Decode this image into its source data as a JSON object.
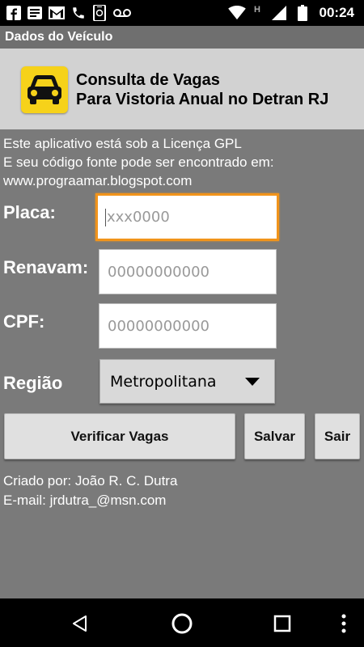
{
  "status_bar": {
    "time": "00:24",
    "network_indicator": "H",
    "icons": [
      "facebook-icon",
      "news-icon",
      "gmail-icon",
      "phone-icon",
      "phone-message-icon",
      "voicemail-icon",
      "wifi-icon",
      "signal-icon",
      "battery-icon"
    ]
  },
  "title_bar": {
    "title": "Dados do Veículo"
  },
  "header": {
    "icon": "car-icon",
    "title_line1": "Consulta de Vagas",
    "title_line2": "Para Vistoria Anual no Detran RJ"
  },
  "info": {
    "line1": "Este aplicativo está sob a Licença GPL",
    "line2": "E seu código fonte pode ser encontrado em:",
    "line3": "www.prograamar.blogspot.com"
  },
  "form": {
    "placa": {
      "label": "Placa:",
      "placeholder": "xxx0000",
      "value": ""
    },
    "renavam": {
      "label": "Renavam:",
      "placeholder": "00000000000",
      "value": ""
    },
    "cpf": {
      "label": "CPF:",
      "placeholder": "00000000000",
      "value": ""
    },
    "regiao": {
      "label": "Região",
      "selected": "Metropolitana"
    }
  },
  "buttons": {
    "verificar": "Verificar Vagas",
    "salvar": "Salvar",
    "sair": "Sair"
  },
  "footer": {
    "author": "Criado por: João R. C. Dutra",
    "email": "E-mail: jrdutra_@msn.com"
  },
  "colors": {
    "status_bar": "#000000",
    "background": "#7a7a7a",
    "header": "#d2d2d2",
    "focus_border": "#f1941b",
    "app_icon": "#f6d21a"
  },
  "nav_bar": {
    "icons": [
      "back-icon",
      "home-icon",
      "recents-icon",
      "menu-icon"
    ]
  }
}
